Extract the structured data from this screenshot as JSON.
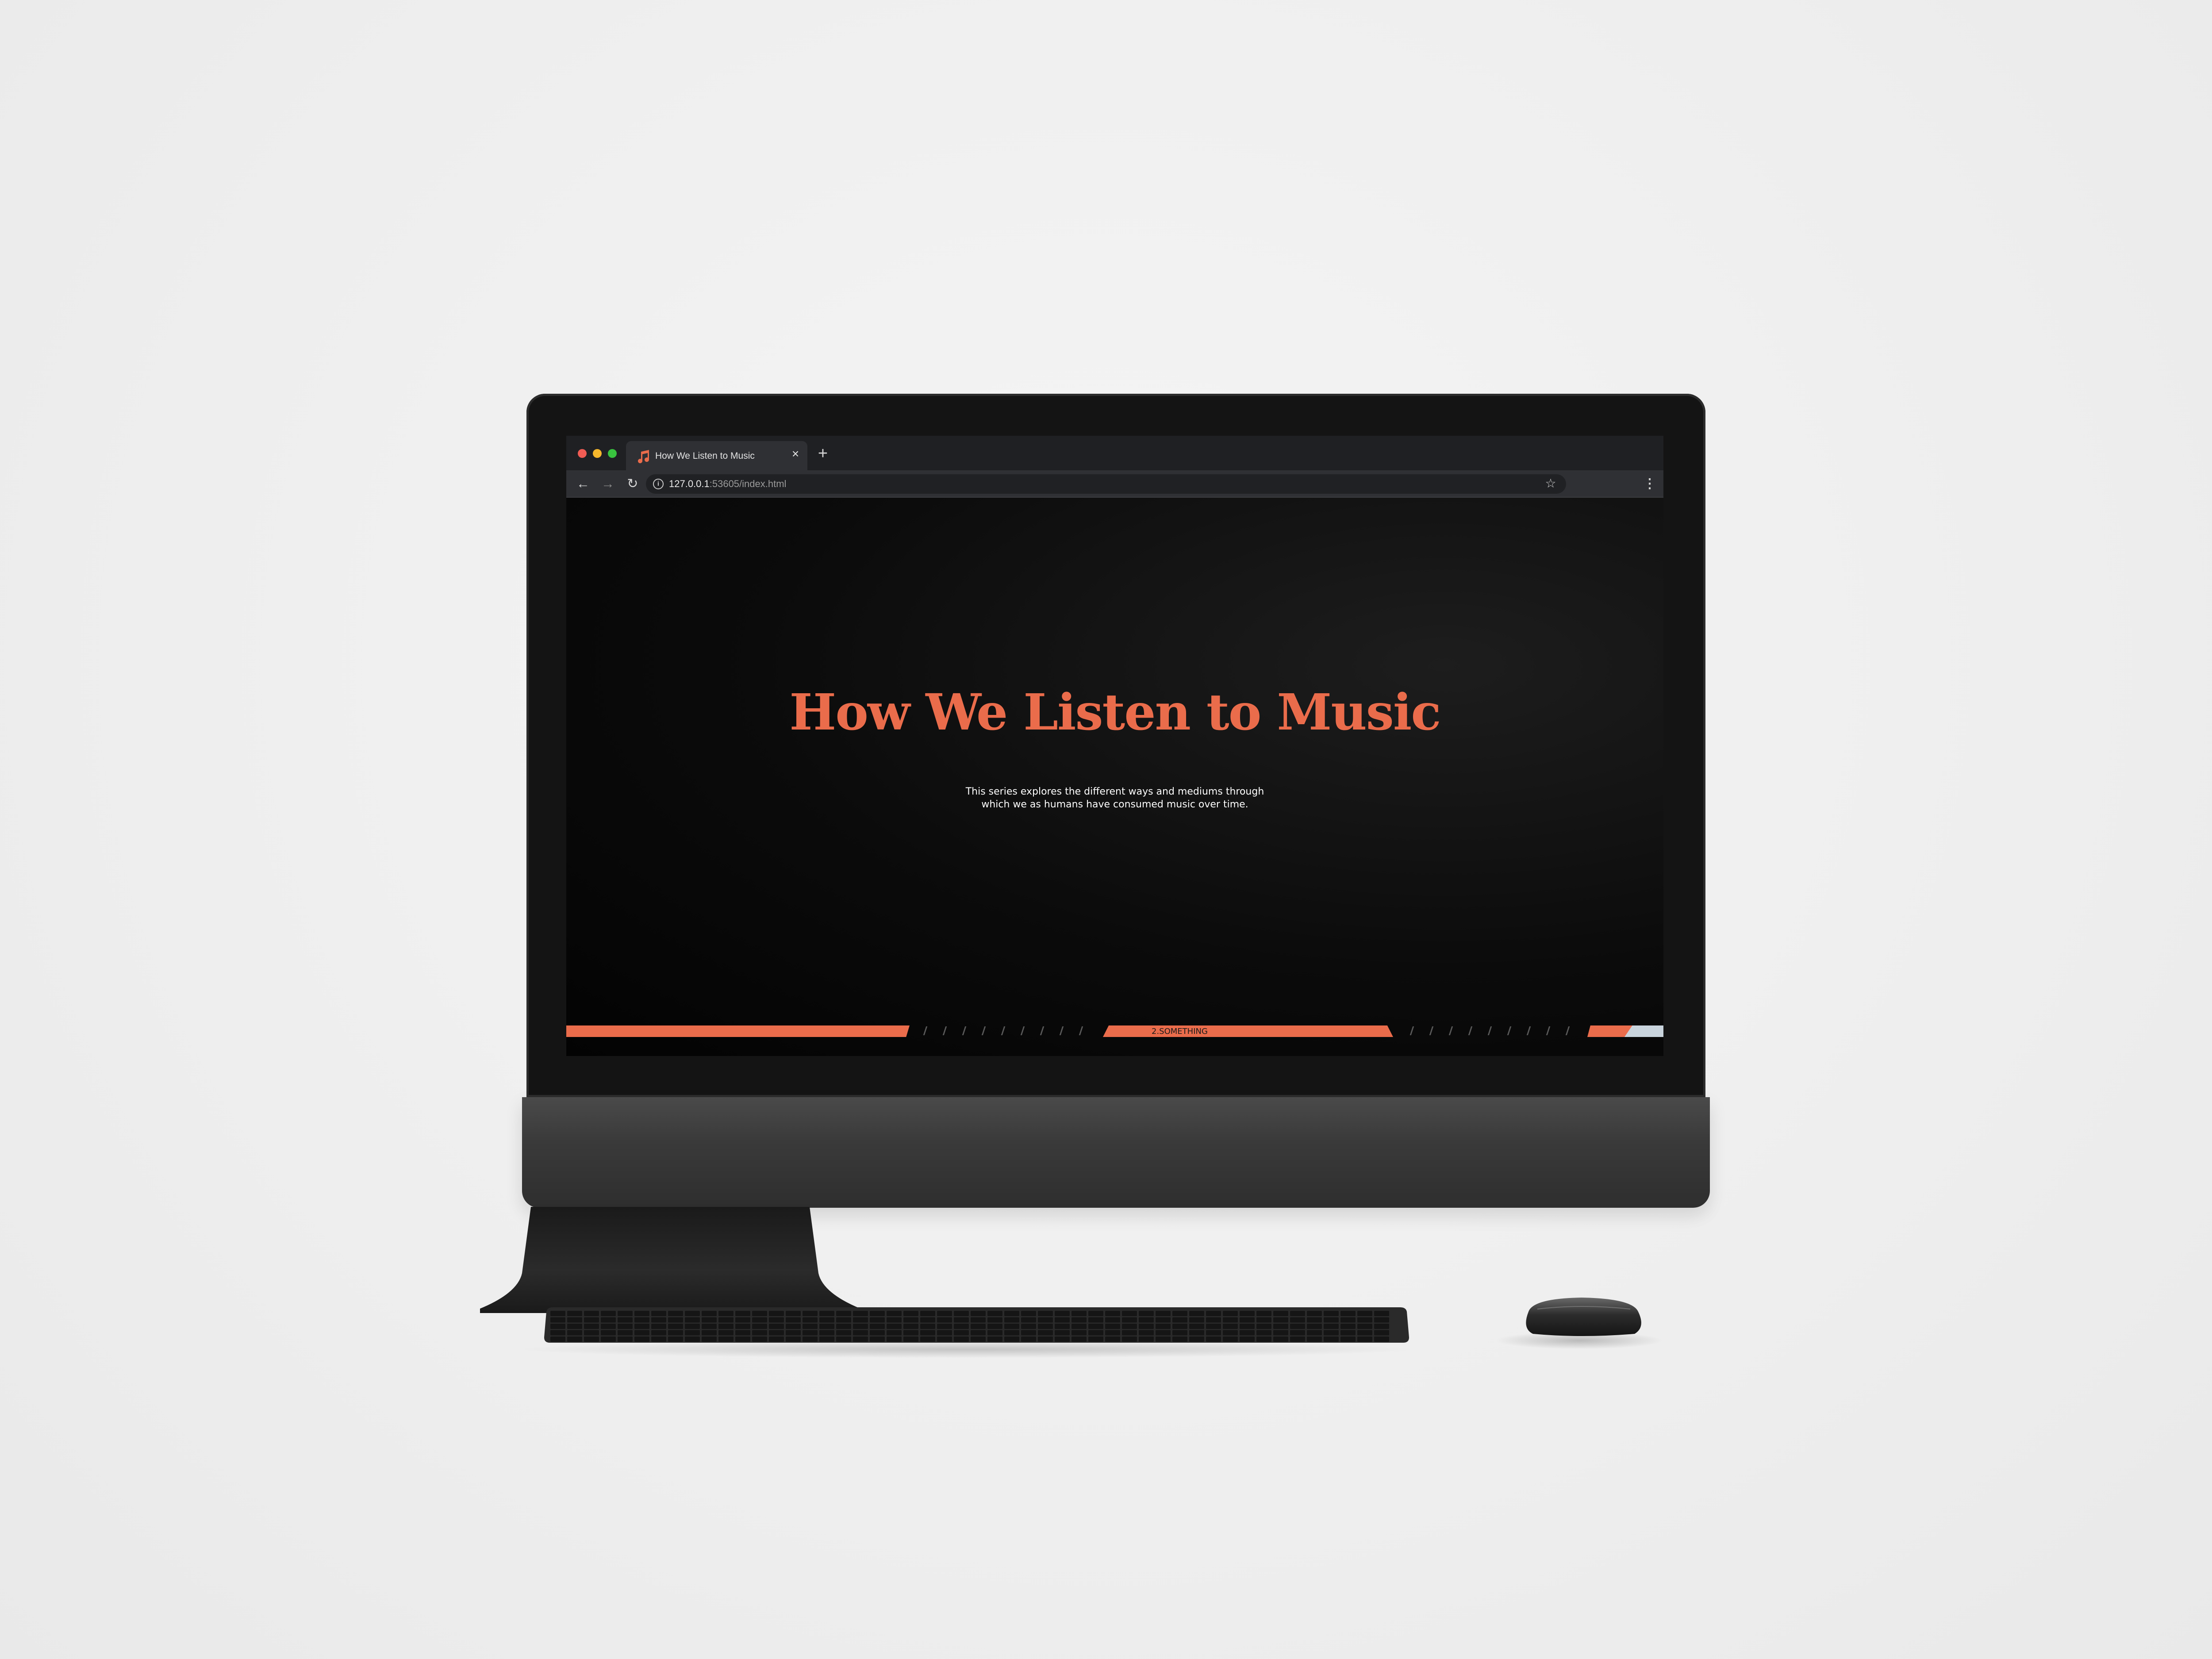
{
  "browser": {
    "tab_title": "How We Listen to Music",
    "tab_close": "×",
    "new_tab": "+",
    "url_host": "127.0.0.1",
    "url_path": ":53605/index.html",
    "back": "←",
    "forward": "→",
    "reload": "↻",
    "bookmark": "☆",
    "menu": "⋮",
    "info": "i"
  },
  "page": {
    "title": "How We Listen to Music",
    "description_line1": "This series explores the different ways and mediums through",
    "description_line2": "which we as humans have consumed music over time.",
    "timeline_label": "2.SOMETHING"
  },
  "colors": {
    "accent": "#ea6c4b",
    "page_bg": "#050505",
    "light_segment": "#c9d4dd"
  },
  "icons": [
    "music-note-icon",
    "info-icon",
    "star-icon",
    "kebab-menu-icon",
    "apple-logo-icon"
  ]
}
